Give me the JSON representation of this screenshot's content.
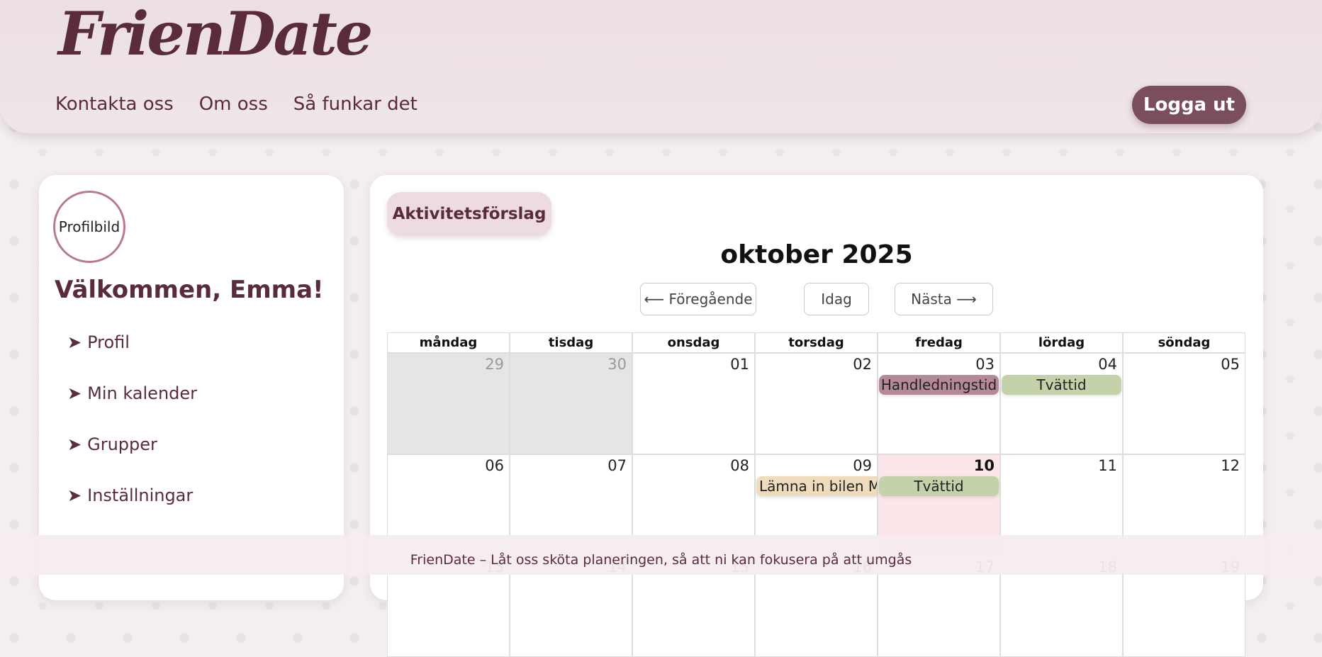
{
  "header": {
    "logo": "FrienDate",
    "nav": [
      "Kontakta oss",
      "Om oss",
      "Så funkar det"
    ],
    "logout_label": "Logga ut"
  },
  "sidebar": {
    "avatar_alt": "Profilbild",
    "welcome": "Välkommen, Emma!",
    "arrow": "➤",
    "items": [
      {
        "label": "Profil"
      },
      {
        "label": "Min kalender"
      },
      {
        "label": "Grupper"
      },
      {
        "label": "Inställningar"
      }
    ]
  },
  "main": {
    "suggest_label": "Aktivitetsförslag",
    "month_title": "oktober 2025",
    "prev_label": "⟵ Föregående",
    "today_label": "Idag",
    "next_label": "Nästa ⟶"
  },
  "calendar": {
    "weekdays": [
      "måndag",
      "tisdag",
      "onsdag",
      "torsdag",
      "fredag",
      "lördag",
      "söndag"
    ],
    "week1": [
      {
        "day": "29",
        "other": true
      },
      {
        "day": "30",
        "other": true
      },
      {
        "day": "01"
      },
      {
        "day": "02"
      },
      {
        "day": "03",
        "event": "Handledningstid",
        "event_color": "#b58a98"
      },
      {
        "day": "04",
        "event": "Tvättid",
        "event_color": "#c4d2aa"
      },
      {
        "day": "05"
      }
    ],
    "week2": [
      {
        "day": "06"
      },
      {
        "day": "07"
      },
      {
        "day": "08"
      },
      {
        "day": "09",
        "event": "Lämna in bilen Me",
        "event_color": "#efdcbc"
      },
      {
        "day": "10",
        "today": true,
        "event": "Tvättid",
        "event_color": "#c4d2aa"
      },
      {
        "day": "11"
      },
      {
        "day": "12"
      }
    ],
    "week3": [
      {
        "day": "13"
      },
      {
        "day": "14"
      },
      {
        "day": "15"
      },
      {
        "day": "16"
      },
      {
        "day": "17"
      },
      {
        "day": "18"
      },
      {
        "day": "19"
      }
    ]
  },
  "footer": {
    "text": "FrienDate – Låt oss sköta planeringen, så att ni kan fokusera på att umgås"
  }
}
